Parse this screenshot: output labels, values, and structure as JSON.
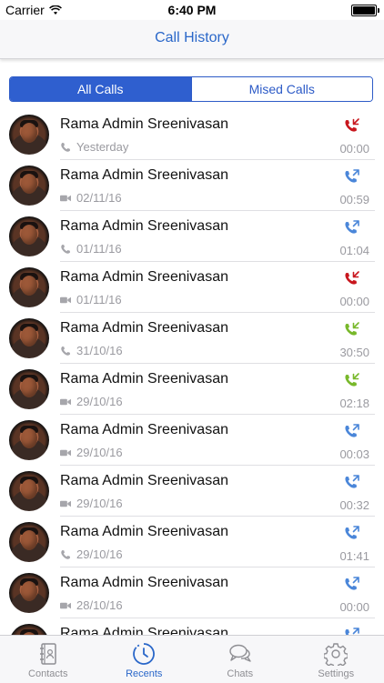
{
  "status_bar": {
    "carrier": "Carrier",
    "time": "6:40 PM"
  },
  "nav": {
    "title": "Call History"
  },
  "filter": {
    "options": [
      "All Calls",
      "Mised Calls"
    ],
    "selected": "All Calls"
  },
  "colors": {
    "accent": "#2a67c9",
    "missed": "#c8161d",
    "outgoing": "#4a86d9",
    "incoming": "#78b82a"
  },
  "calls": [
    {
      "name": "Rama Admin Sreenivasan",
      "type": "phone-icon",
      "date": "Yesterday",
      "direction": "missed",
      "duration": "00:00"
    },
    {
      "name": "Rama Admin Sreenivasan",
      "type": "video-icon",
      "date": "02/11/16",
      "direction": "outgoing",
      "duration": "00:59"
    },
    {
      "name": "Rama Admin Sreenivasan",
      "type": "phone-icon",
      "date": "01/11/16",
      "direction": "outgoing",
      "duration": "01:04"
    },
    {
      "name": "Rama Admin Sreenivasan",
      "type": "video-icon",
      "date": "01/11/16",
      "direction": "missed",
      "duration": "00:00"
    },
    {
      "name": "Rama Admin Sreenivasan",
      "type": "phone-icon",
      "date": "31/10/16",
      "direction": "incoming",
      "duration": "30:50"
    },
    {
      "name": "Rama Admin Sreenivasan",
      "type": "video-icon",
      "date": "29/10/16",
      "direction": "incoming",
      "duration": "02:18"
    },
    {
      "name": "Rama Admin Sreenivasan",
      "type": "video-icon",
      "date": "29/10/16",
      "direction": "outgoing",
      "duration": "00:03"
    },
    {
      "name": "Rama Admin Sreenivasan",
      "type": "video-icon",
      "date": "29/10/16",
      "direction": "outgoing",
      "duration": "00:32"
    },
    {
      "name": "Rama Admin Sreenivasan",
      "type": "phone-icon",
      "date": "29/10/16",
      "direction": "outgoing",
      "duration": "01:41"
    },
    {
      "name": "Rama Admin Sreenivasan",
      "type": "video-icon",
      "date": "28/10/16",
      "direction": "outgoing",
      "duration": "00:00"
    },
    {
      "name": "Rama Admin Sreenivasan",
      "type": "phone-icon",
      "date": "",
      "direction": "outgoing",
      "duration": ""
    }
  ],
  "tabs": [
    {
      "label": "Contacts",
      "icon": "contacts-book-icon",
      "active": false
    },
    {
      "label": "Recents",
      "icon": "clock-icon",
      "active": true
    },
    {
      "label": "Chats",
      "icon": "chat-bubbles-icon",
      "active": false
    },
    {
      "label": "Settings",
      "icon": "gear-icon",
      "active": false
    }
  ]
}
